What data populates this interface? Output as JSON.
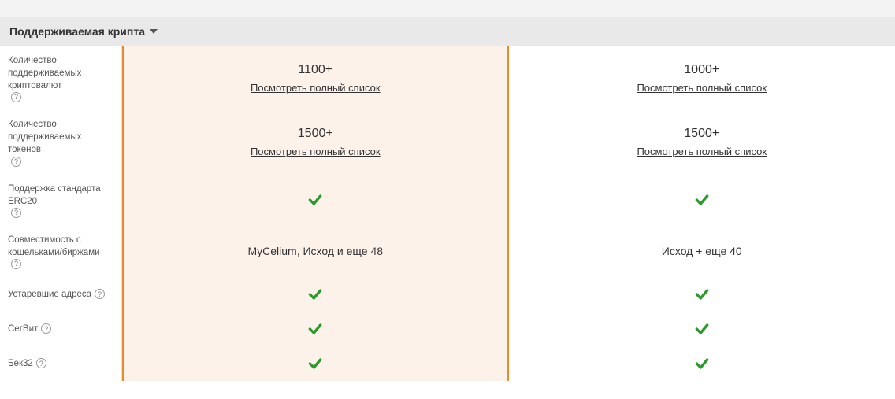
{
  "section_title": "Поддерживаемая крипта",
  "help_symbol": "?",
  "link_text": "Посмотреть полный список",
  "rows": [
    {
      "label": "Количество поддерживаемых криптовалют",
      "has_help": true,
      "col1": {
        "value": "1100+",
        "has_link": true
      },
      "col2": {
        "value": "1000+",
        "has_link": true
      }
    },
    {
      "label": "Количество поддерживаемых токенов",
      "has_help": true,
      "col1": {
        "value": "1500+",
        "has_link": true
      },
      "col2": {
        "value": "1500+",
        "has_link": true
      }
    },
    {
      "label": "Поддержка стандарта ERC20",
      "has_help": true,
      "col1": {
        "check": true
      },
      "col2": {
        "check": true
      }
    },
    {
      "label": "Совместимость с кошельками/биржами",
      "has_help": true,
      "col1": {
        "text": "MyCelium, Исход и еще 48"
      },
      "col2": {
        "text": "Исход + еще 40"
      }
    },
    {
      "label": "Устаревшие адреса",
      "has_help": true,
      "col1": {
        "check": true
      },
      "col2": {
        "check": true
      }
    },
    {
      "label": "СегВит",
      "has_help": true,
      "col1": {
        "check": true
      },
      "col2": {
        "check": true
      }
    },
    {
      "label": "Бек32",
      "has_help": true,
      "col1": {
        "check": true
      },
      "col2": {
        "check": true
      }
    }
  ]
}
